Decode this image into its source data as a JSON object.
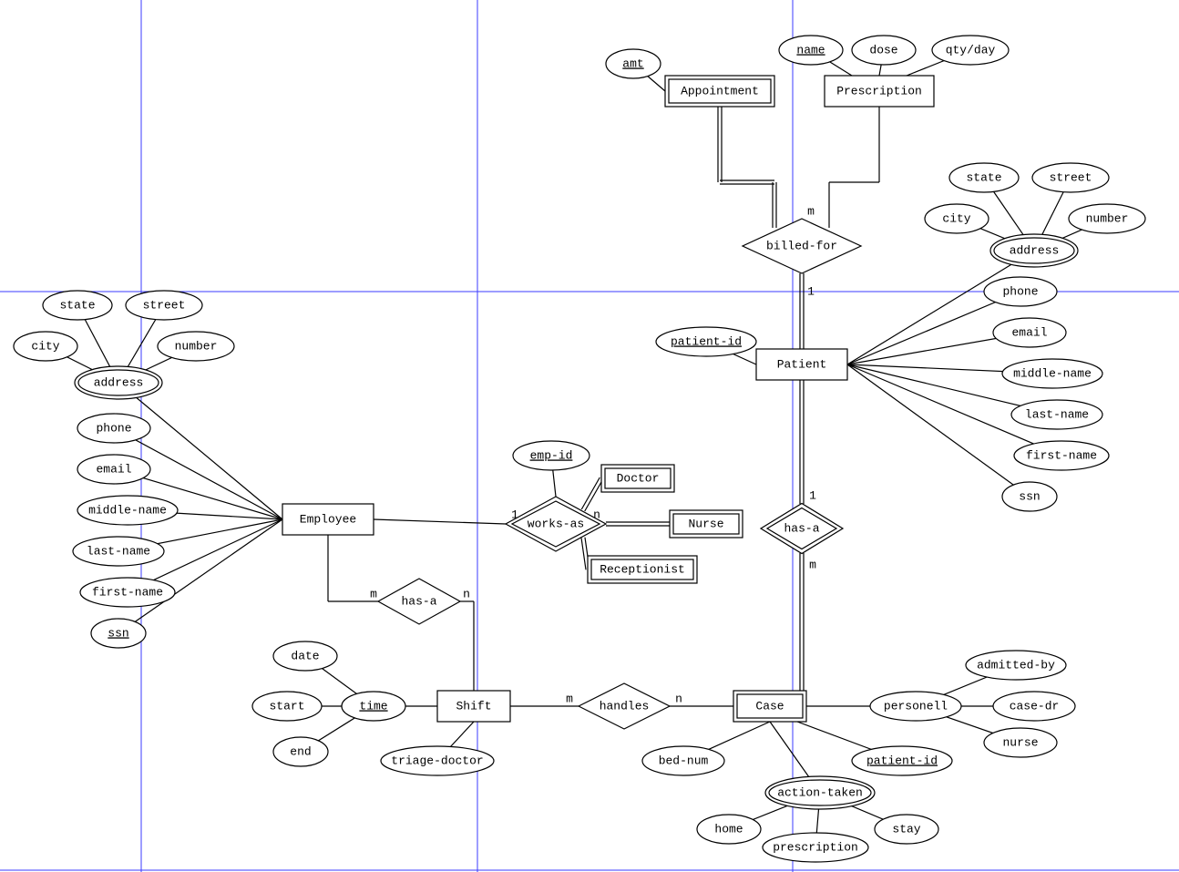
{
  "gridColor": "#3b3bff",
  "gridVerticals": [
    155,
    524,
    870
  ],
  "gridHorizontals": [
    320,
    955
  ],
  "entities": {
    "appointment": {
      "label": "Appointment",
      "weak": true
    },
    "prescription": {
      "label": "Prescription",
      "weak": false
    },
    "patient": {
      "label": "Patient",
      "weak": false
    },
    "employee": {
      "label": "Employee",
      "weak": false
    },
    "doctor": {
      "label": "Doctor",
      "weak": true
    },
    "nurse": {
      "label": "Nurse",
      "weak": true
    },
    "receptionist": {
      "label": "Receptionist",
      "weak": true
    },
    "shift": {
      "label": "Shift",
      "weak": false
    },
    "case": {
      "label": "Case",
      "weak": true
    }
  },
  "relationships": {
    "billedfor": {
      "label": "billed-for",
      "weak": false
    },
    "worksas": {
      "label": "works-as",
      "weak": true
    },
    "hasa_emp": {
      "label": "has-a",
      "weak": false
    },
    "hasa_pat": {
      "label": "has-a",
      "weak": true
    },
    "handles": {
      "label": "handles",
      "weak": false
    }
  },
  "attributes": {
    "amt": {
      "label": "amt",
      "key": true
    },
    "presc_name": {
      "label": "name",
      "key": true
    },
    "dose": {
      "label": "dose"
    },
    "qtyday": {
      "label": "qty/day"
    },
    "pat_state": {
      "label": "state"
    },
    "pat_street": {
      "label": "street"
    },
    "pat_city": {
      "label": "city"
    },
    "pat_number": {
      "label": "number"
    },
    "pat_address": {
      "label": "address",
      "multi": true
    },
    "pat_phone": {
      "label": "phone"
    },
    "pat_email": {
      "label": "email"
    },
    "pat_middle": {
      "label": "middle-name"
    },
    "pat_last": {
      "label": "last-name"
    },
    "pat_first": {
      "label": "first-name"
    },
    "pat_ssn": {
      "label": "ssn"
    },
    "patient_id": {
      "label": "patient-id",
      "key": true
    },
    "emp_state": {
      "label": "state"
    },
    "emp_street": {
      "label": "street"
    },
    "emp_city": {
      "label": "city"
    },
    "emp_number": {
      "label": "number"
    },
    "emp_address": {
      "label": "address",
      "multi": true
    },
    "emp_phone": {
      "label": "phone"
    },
    "emp_email": {
      "label": "email"
    },
    "emp_middle": {
      "label": "middle-name"
    },
    "emp_last": {
      "label": "last-name"
    },
    "emp_first": {
      "label": "first-name"
    },
    "emp_ssn": {
      "label": "ssn",
      "key": true
    },
    "emp_id": {
      "label": "emp-id",
      "key": true
    },
    "shift_date": {
      "label": "date"
    },
    "shift_start": {
      "label": "start"
    },
    "shift_end": {
      "label": "end"
    },
    "shift_time": {
      "label": "time",
      "key": true
    },
    "shift_triage": {
      "label": "triage-doctor"
    },
    "case_bednum": {
      "label": "bed-num"
    },
    "case_personell": {
      "label": "personell"
    },
    "case_admittedby": {
      "label": "admitted-by"
    },
    "case_casedr": {
      "label": "case-dr"
    },
    "case_nurse": {
      "label": "nurse"
    },
    "case_patientid": {
      "label": "patient-id",
      "partial": true
    },
    "case_actiontaken": {
      "label": "action-taken",
      "multi": true
    },
    "case_home": {
      "label": "home"
    },
    "case_stay": {
      "label": "stay"
    },
    "case_prescription": {
      "label": "prescription"
    }
  },
  "cardinalities": {
    "billedfor_top": "m",
    "billedfor_bot": "1",
    "worksas_left": "1",
    "worksas_right": "n",
    "hasa_emp_left": "m",
    "hasa_emp_right": "n",
    "handles_left": "m",
    "handles_right": "n",
    "hasa_pat_top": "1",
    "hasa_pat_bot": "m"
  }
}
